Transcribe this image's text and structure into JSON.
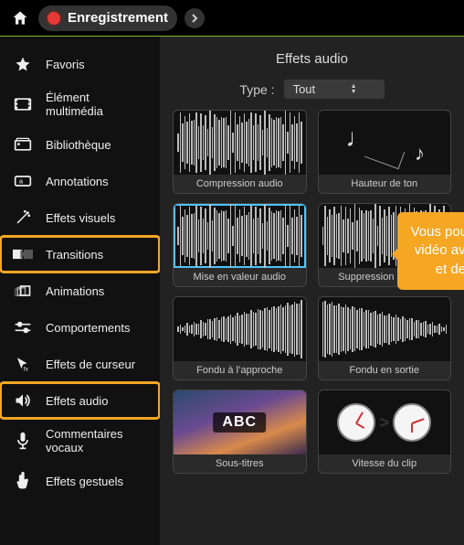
{
  "topbar": {
    "record_label": "Enregistrement"
  },
  "sidebar": {
    "items": [
      {
        "label": "Favoris",
        "icon": "star-icon",
        "highlight": false
      },
      {
        "label": "Élément multimédia",
        "icon": "filmstrip-icon",
        "highlight": false
      },
      {
        "label": "Bibliothèque",
        "icon": "library-icon",
        "highlight": false
      },
      {
        "label": "Annotations",
        "icon": "annotation-icon",
        "highlight": false
      },
      {
        "label": "Effets visuels",
        "icon": "wand-icon",
        "highlight": false
      },
      {
        "label": "Transitions",
        "icon": "transitions-icon",
        "highlight": true
      },
      {
        "label": "Animations",
        "icon": "animations-icon",
        "highlight": false
      },
      {
        "label": "Comportements",
        "icon": "sliders-icon",
        "highlight": false
      },
      {
        "label": "Effets de curseur",
        "icon": "cursor-icon",
        "highlight": false
      },
      {
        "label": "Effets audio",
        "icon": "speaker-icon",
        "highlight": true
      },
      {
        "label": "Commentaires vocaux",
        "icon": "microphone-icon",
        "highlight": false
      },
      {
        "label": "Effets gestuels",
        "icon": "gesture-icon",
        "highlight": false
      }
    ]
  },
  "panel": {
    "title": "Effets audio",
    "type_label": "Type :",
    "type_value": "Tout",
    "tiles": [
      {
        "label": "Compression audio",
        "kind": "wave-dense",
        "selected": false
      },
      {
        "label": "Hauteur de ton",
        "kind": "notes",
        "selected": false
      },
      {
        "label": "Mise en valeur audio",
        "kind": "wave-dense",
        "selected": true
      },
      {
        "label": "Suppression du bruit",
        "kind": "wave-dense",
        "selected": false
      },
      {
        "label": "Fondu à l’approche",
        "kind": "fade-in",
        "selected": false
      },
      {
        "label": "Fondu en sortie",
        "kind": "fade-out",
        "selected": false
      },
      {
        "label": "Sous-titres",
        "kind": "subtitles",
        "selected": false
      },
      {
        "label": "Vitesse du clip",
        "kind": "clocks",
        "selected": false
      }
    ],
    "subtitle_text": "ABC"
  },
  "callout": {
    "text": "Vous pouvez modifier votre vidéo avec des transitions et des effets audio."
  }
}
